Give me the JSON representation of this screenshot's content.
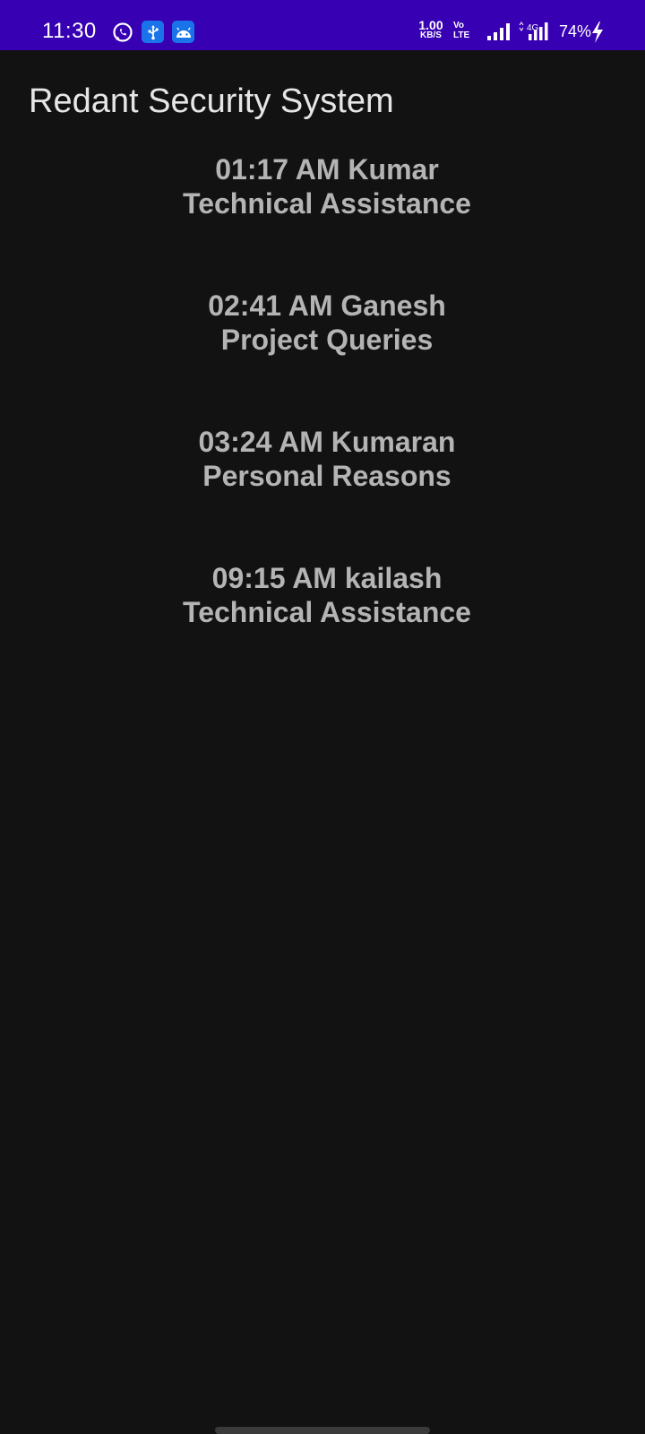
{
  "status_bar": {
    "time": "11:30",
    "net_speed_value": "1.00",
    "net_speed_unit": "KB/S",
    "volte_line1": "Vo",
    "volte_line2": "LTE",
    "network_type": "4G",
    "battery": "74%",
    "bg_color": "#3700b3",
    "icons": [
      "whatsapp-icon",
      "usb-icon",
      "android-icon",
      "signal-icon",
      "signal-4g-icon",
      "charging-bolt-icon"
    ]
  },
  "app": {
    "title": "Redant Security System"
  },
  "entries": [
    {
      "line1": "01:17 AM Kumar",
      "line2": "Technical Assistance"
    },
    {
      "line1": "02:41 AM Ganesh",
      "line2": "Project Queries"
    },
    {
      "line1": "03:24 AM Kumaran",
      "line2": "Personal Reasons"
    },
    {
      "line1": "09:15 AM kailash",
      "line2": "Technical Assistance"
    }
  ]
}
